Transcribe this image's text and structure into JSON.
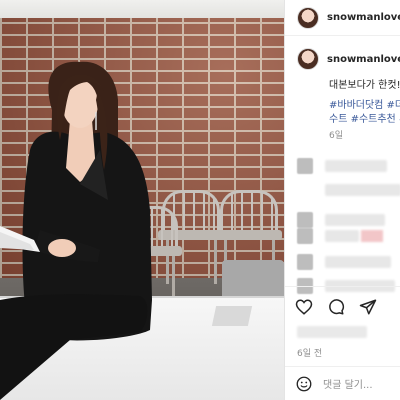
{
  "post": {
    "username": "snowmanloveu",
    "caption_line1": "대본보다가 한컷!",
    "hashtags_line1": "#바바더닷컴 #더",
    "hashtags_line2": "수트 #수트추천 #",
    "caption_time": "6일",
    "post_time": "6일 전",
    "comment_placeholder": "댓글 달기..."
  },
  "icons": {
    "like": "heart-icon",
    "comment": "comment-bubble-icon",
    "share": "paper-plane-icon",
    "emoji": "smiley-icon"
  },
  "colors": {
    "hashtag": "#3b5a9a",
    "muted": "#8e8e8e",
    "text": "#262626"
  }
}
